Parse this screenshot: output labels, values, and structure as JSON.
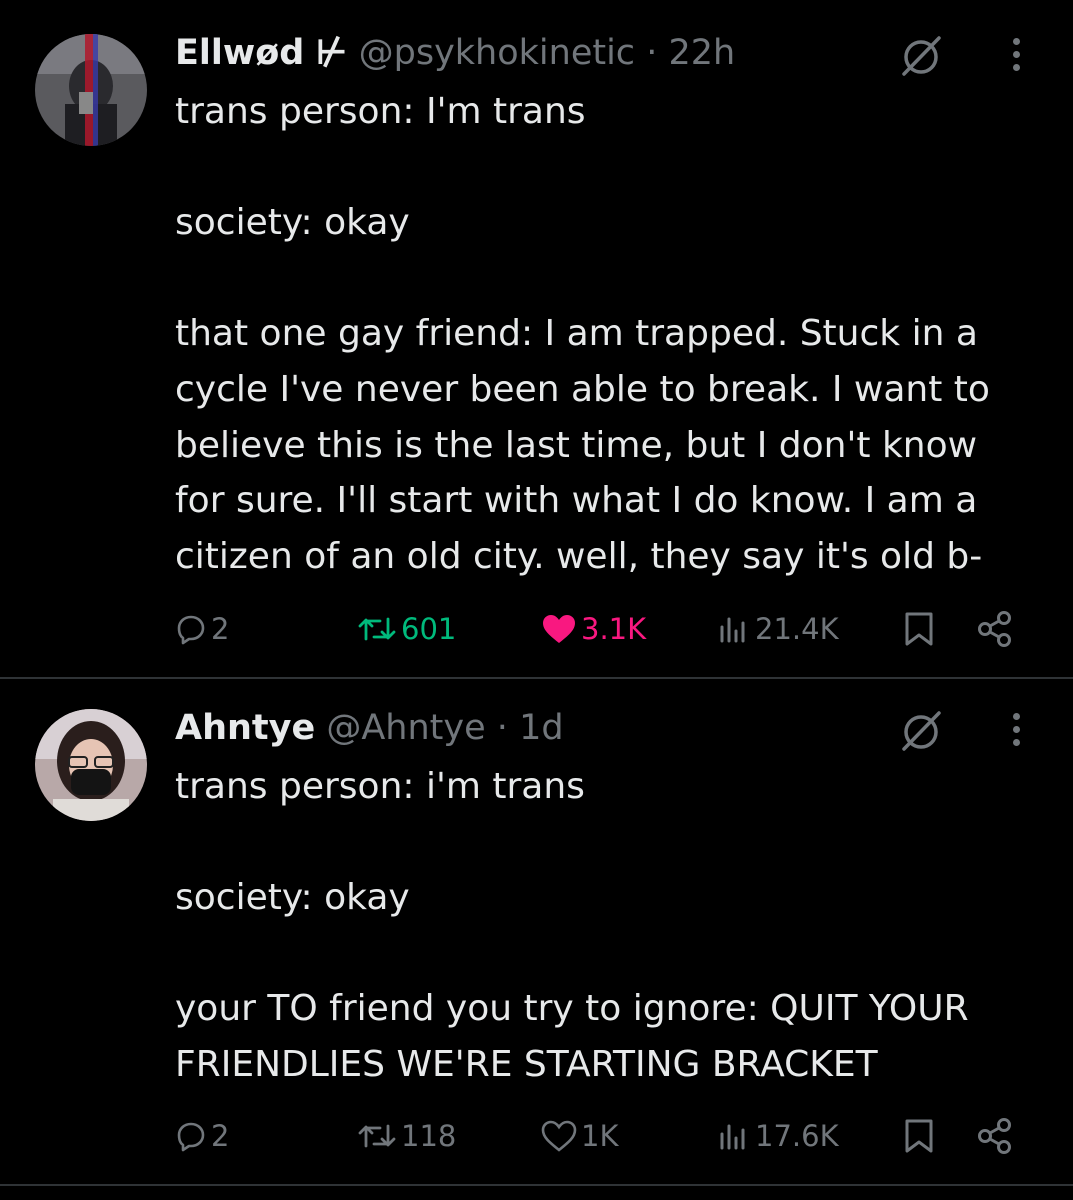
{
  "tweets": [
    {
      "display_name": "Ellwød",
      "name_glyph": "⊬",
      "handle": "@psykhokinetic",
      "dot": "·",
      "time": "22h",
      "text": "trans person: I'm trans\n\nsociety: okay\n\nthat one gay friend: I am trapped. Stuck in a cycle I've never been able to break. I want to believe this is the last time, but I don't know for sure. I'll start with what I do know. I am a citizen of an old city. well, they say it's old b-",
      "replies": "2",
      "retweets": "601",
      "likes": "3.1K",
      "views": "21.4K",
      "retweeted": true,
      "liked": true,
      "colors": {
        "retweet": "#00ba7c",
        "like": "#f91880"
      }
    },
    {
      "display_name": "Ahntye",
      "handle": "@Ahntye",
      "dot": "·",
      "time": "1d",
      "text": "trans person: i'm trans\n\nsociety: okay\n\nyour TO friend you try to ignore: QUIT YOUR FRIENDLIES WE'RE STARTING BRACKET",
      "replies": "2",
      "retweets": "118",
      "likes": "1K",
      "views": "17.6K",
      "retweeted": false,
      "liked": false
    }
  ],
  "icons": {
    "reply": "reply-bubble-icon",
    "retweet": "retweet-icon",
    "like": "heart-icon",
    "views": "views-bar-chart-icon",
    "bookmark": "bookmark-icon",
    "share": "share-icon",
    "grok": "grok-slash-circle-icon",
    "more": "more-vertical-dots-icon"
  }
}
